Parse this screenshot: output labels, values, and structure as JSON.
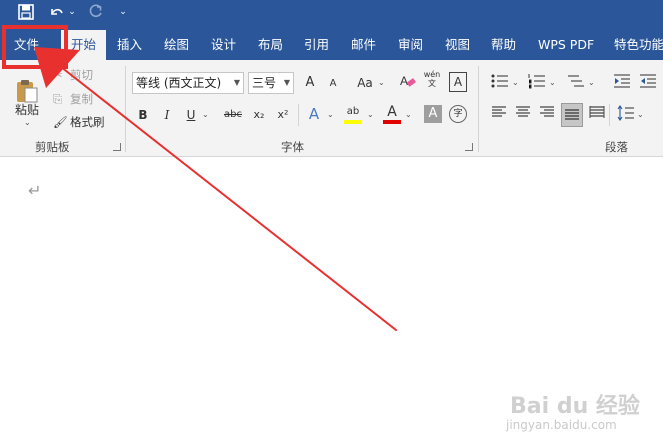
{
  "quick_access": {
    "save_icon": "save-icon",
    "undo_icon": "undo-icon",
    "undo_menu": "⌄",
    "redo_icon": "redo-icon",
    "customize": "⌄"
  },
  "tabs": [
    "文件",
    "开始",
    "插入",
    "绘图",
    "设计",
    "布局",
    "引用",
    "邮件",
    "审阅",
    "视图",
    "帮助",
    "WPS PDF",
    "特色功能"
  ],
  "clipboard": {
    "paste_label": "粘贴",
    "cut_label": "剪切",
    "copy_label": "复制",
    "format_painter_label": "格式刷",
    "group_label": "剪贴板"
  },
  "font": {
    "font_name": "等线 (西文正文)",
    "font_size": "三号",
    "grow": "A",
    "shrink": "A",
    "change_case": "Aa",
    "phonetic": "wén\n文",
    "border_char": "A",
    "bold": "B",
    "italic": "I",
    "underline": "U",
    "strike": "abc",
    "subscript": "x₂",
    "superscript": "x²",
    "effects": "A",
    "highlight": "ab",
    "font_color": "A",
    "shading": "A",
    "enclose": "字",
    "group_label": "字体"
  },
  "paragraph": {
    "group_label": "段落"
  },
  "colors": {
    "brand": "#2b579a",
    "ribbon_bg": "#f3f3f3",
    "annotation_red": "#e8312f",
    "highlight_yellow": "#ffff00",
    "font_color_red": "#e00000"
  },
  "document": {
    "paragraph_mark": "↵"
  },
  "watermark": {
    "logo": "Bai du 经验",
    "url": "jingyan.baidu.com"
  }
}
